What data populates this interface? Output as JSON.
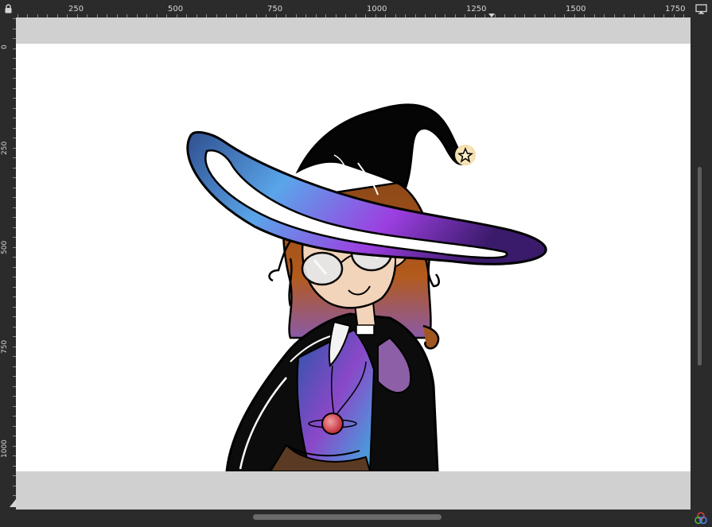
{
  "ruler": {
    "horizontal_labels": [
      "250",
      "500",
      "750",
      "1000",
      "1250",
      "1500",
      "1750"
    ],
    "vertical_labels": [
      "0",
      "250",
      "500",
      "750",
      "1000"
    ]
  },
  "icons": {
    "lock": "lock-icon",
    "display": "monitor-icon",
    "color_management": "color-circles-icon",
    "navigate": "navigate-icon"
  },
  "colors": {
    "ui_background": "#2b2b2b",
    "canvas_padding": "#d0d0d0",
    "paper": "#ffffff",
    "hat_gradient": [
      "#3a5fa8",
      "#5ea2e8",
      "#9a3dd8",
      "#6a1fb0"
    ],
    "hair": "#a0561e",
    "skin": "#f2d4ba",
    "coat": "#0d0d0d"
  }
}
